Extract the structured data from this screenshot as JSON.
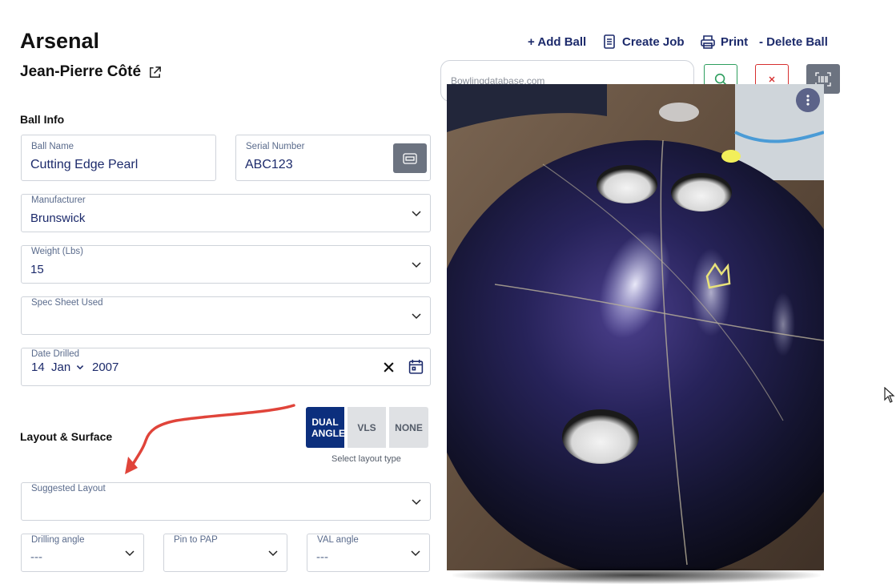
{
  "header": {
    "title": "Arsenal",
    "owner": "Jean-Pierre Côté"
  },
  "toolbar": {
    "add_ball": "+ Add Ball",
    "create_job": "Create Job",
    "print": "Print",
    "delete_ball": "- Delete Ball"
  },
  "search": {
    "placeholder": "Bowlingdatabase.com"
  },
  "ball_info": {
    "heading": "Ball Info",
    "ball_name": {
      "label": "Ball Name",
      "value": "Cutting Edge Pearl"
    },
    "serial_number": {
      "label": "Serial Number",
      "value": "ABC123"
    },
    "manufacturer": {
      "label": "Manufacturer",
      "value": "Brunswick"
    },
    "weight": {
      "label": "Weight (Lbs)",
      "value": "15"
    },
    "spec_sheet": {
      "label": "Spec Sheet Used",
      "value": ""
    },
    "date_drilled": {
      "label": "Date Drilled",
      "day": "14",
      "month": "Jan",
      "year": "2007"
    }
  },
  "layout_surface": {
    "heading": "Layout & Surface",
    "layout_types": [
      "DUAL ANGLE",
      "VLS",
      "NONE"
    ],
    "selected_layout_type": "DUAL ANGLE",
    "layout_type_note": "Select layout type",
    "suggested_layout": {
      "label": "Suggested Layout",
      "value": ""
    },
    "drilling_angle": {
      "label": "Drilling angle",
      "value": "---"
    },
    "pin_to_pap": {
      "label": "Pin to PAP",
      "value": ""
    },
    "val_angle": {
      "label": "VAL angle",
      "value": "---"
    }
  },
  "colors": {
    "accent_navy": "#0c2f7d",
    "text_navy": "#1c2a6b",
    "search_green": "#2e9e5e",
    "close_red": "#d62f2f",
    "annotation_arrow": "#e0443a"
  },
  "icons": {
    "owner_link": "external-link-icon",
    "create_job": "document-icon",
    "print": "printer-icon",
    "search": "search-icon",
    "clear": "close-icon",
    "barcode": "barcode-scan-icon",
    "serial_scan": "scan-icon",
    "date_clear": "close-icon",
    "calendar": "calendar-icon",
    "dropdown": "chevron-down-icon",
    "menu": "kebab-menu-icon"
  }
}
